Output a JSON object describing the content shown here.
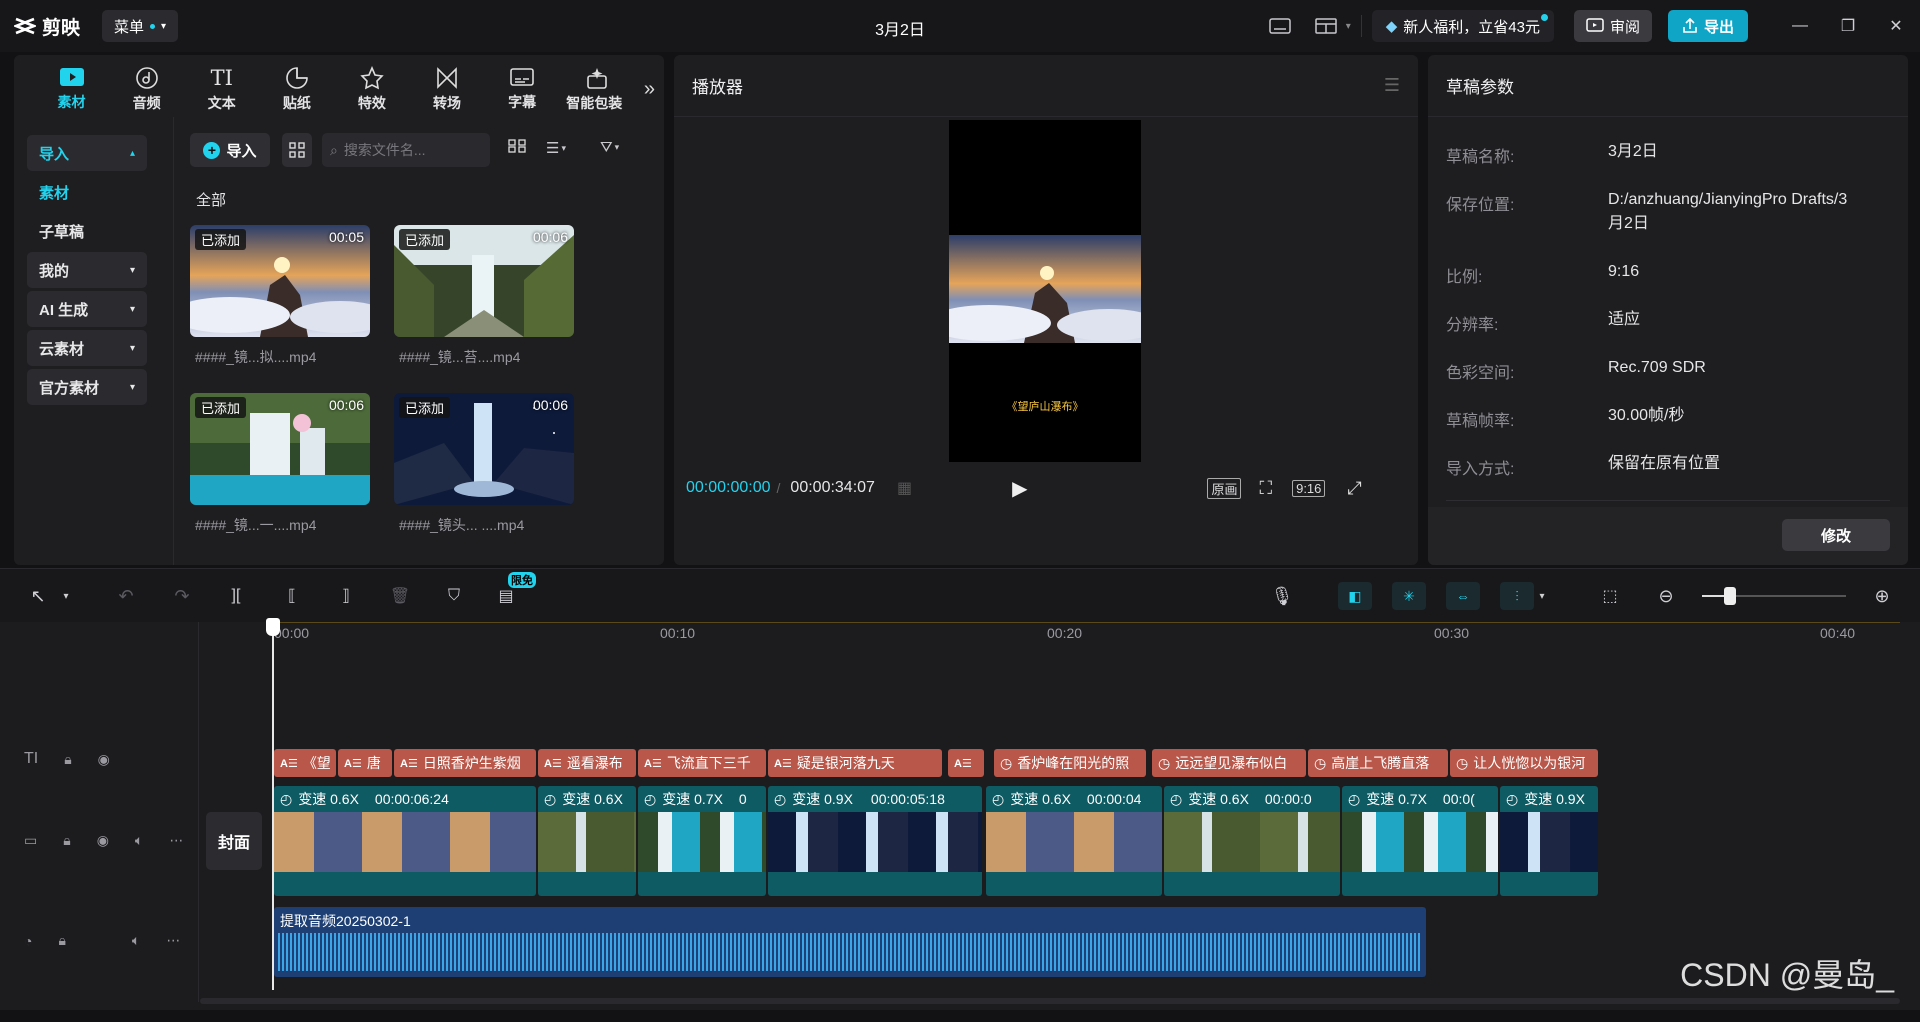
{
  "app": {
    "logo_text": "剪映",
    "menu_label": "菜单",
    "title": "3月2日"
  },
  "titlebar": {
    "promo": "新人福利，立省43元",
    "review": "审阅",
    "export": "导出"
  },
  "media_tabs": [
    {
      "label": "素材",
      "icon": "media-icon"
    },
    {
      "label": "音频",
      "icon": "audio-icon"
    },
    {
      "label": "文本",
      "icon": "text-icon"
    },
    {
      "label": "贴纸",
      "icon": "sticker-icon"
    },
    {
      "label": "特效",
      "icon": "effects-icon"
    },
    {
      "label": "转场",
      "icon": "transition-icon"
    },
    {
      "label": "字幕",
      "icon": "subtitle-icon"
    },
    {
      "label": "智能包装",
      "icon": "smart-pack-icon"
    }
  ],
  "sidebar": {
    "import": "导入",
    "media": "素材",
    "sub_draft": "子草稿",
    "mine": "我的",
    "ai": "AI 生成",
    "cloud": "云素材",
    "official": "官方素材"
  },
  "assets": {
    "import_label": "导入",
    "search_placeholder": "搜索文件名...",
    "all_label": "全部",
    "items": [
      {
        "tag": "已添加",
        "duration": "00:05",
        "name": "####_镜...拟....mp4",
        "scene": "sunrise"
      },
      {
        "tag": "已添加",
        "duration": "00:06",
        "name": "####_镜...苔....mp4",
        "scene": "forest"
      },
      {
        "tag": "已添加",
        "duration": "00:06",
        "name": "####_镜...一....mp4",
        "scene": "falls"
      },
      {
        "tag": "已添加",
        "duration": "00:06",
        "name": "####_镜头...  ....mp4",
        "scene": "night"
      }
    ]
  },
  "player": {
    "title": "播放器",
    "caption": "《望庐山瀑布》",
    "time_current": "00:00:00:00",
    "time_total": "00:00:34:07",
    "btn_original": "原画",
    "btn_ratio": "9:16"
  },
  "draft": {
    "title": "草稿参数",
    "rows": [
      {
        "label": "草稿名称:",
        "value": "3月2日"
      },
      {
        "label": "保存位置:",
        "value": "D:/anzhuang/JianyingPro Drafts/3月2日"
      },
      {
        "label": "比例:",
        "value": "9:16"
      },
      {
        "label": "分辨率:",
        "value": "适应"
      },
      {
        "label": "色彩空间:",
        "value": "Rec.709 SDR"
      },
      {
        "label": "草稿帧率:",
        "value": "30.00帧/秒"
      },
      {
        "label": "导入方式:",
        "value": "保留在原有位置"
      }
    ],
    "modify": "修改"
  },
  "timeline_tools": {
    "free_badge": "限免"
  },
  "ruler": [
    "00:00",
    "00:10",
    "00:20",
    "00:30",
    "00:40"
  ],
  "tracks": {
    "cover": "封面",
    "text_clips": [
      "《望",
      "唐",
      "日照香炉生紫烟",
      "遥看瀑布",
      "飞流直下三千",
      "疑是银河落九天",
      "",
      "香炉峰在阳光的照",
      "远远望见瀑布似白",
      "高崖上飞腾直落",
      "让人恍惚以为银河"
    ],
    "video_clips": [
      {
        "speed": "变速 0.6X",
        "time": "00:00:06:24",
        "scene": "sunrise"
      },
      {
        "speed": "变速 0.6X",
        "time": "",
        "scene": "forest"
      },
      {
        "speed": "变速 0.7X",
        "time": "0",
        "scene": "falls"
      },
      {
        "speed": "变速 0.9X",
        "time": "00:00:05:18",
        "scene": "night"
      },
      {
        "speed": "变速 0.6X",
        "time": "00:00:04",
        "scene": "sunrise"
      },
      {
        "speed": "变速 0.6X",
        "time": "00:00:0",
        "scene": "forest"
      },
      {
        "speed": "变速 0.7X",
        "time": "00:0(",
        "scene": "falls"
      },
      {
        "speed": "变速 0.9X",
        "time": "",
        "scene": "night"
      }
    ],
    "audio_name": "提取音频20250302-1"
  },
  "watermark": "CSDN @曼岛_"
}
